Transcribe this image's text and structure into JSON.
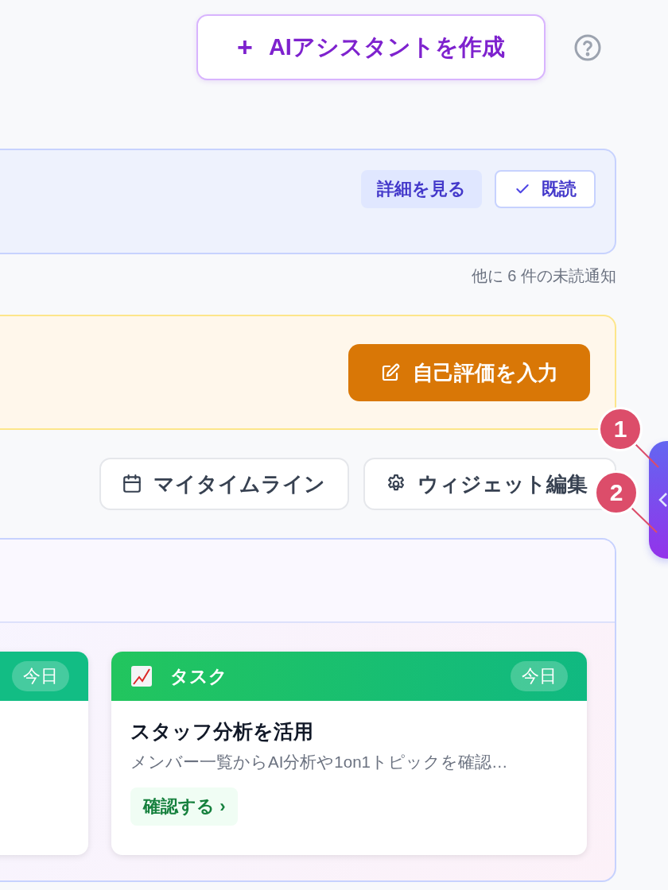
{
  "header": {
    "create_button": {
      "icon": "+",
      "label": "AIアシスタントを作成"
    }
  },
  "notification": {
    "details_button": "詳細を見る",
    "read_button": "既読",
    "more_text": "他に 6 件の未読通知"
  },
  "self_evaluation": {
    "button": "自己評価を入力"
  },
  "actions": [
    {
      "kind": "calendar",
      "label": "マイタイムライン"
    },
    {
      "kind": "settings",
      "label": "ウィジェット編集"
    }
  ],
  "widget": {
    "cards": [
      {
        "date_badge": "今日"
      },
      {
        "category": "タスク",
        "date_badge": "今日",
        "title": "スタッフ分析を活用",
        "description": "メンバー一覧からAI分析や1on1トピックを確認…",
        "action": "確認する",
        "action_icon": "›"
      }
    ]
  },
  "annotations": [
    {
      "label": "1"
    },
    {
      "label": "2"
    }
  ]
}
